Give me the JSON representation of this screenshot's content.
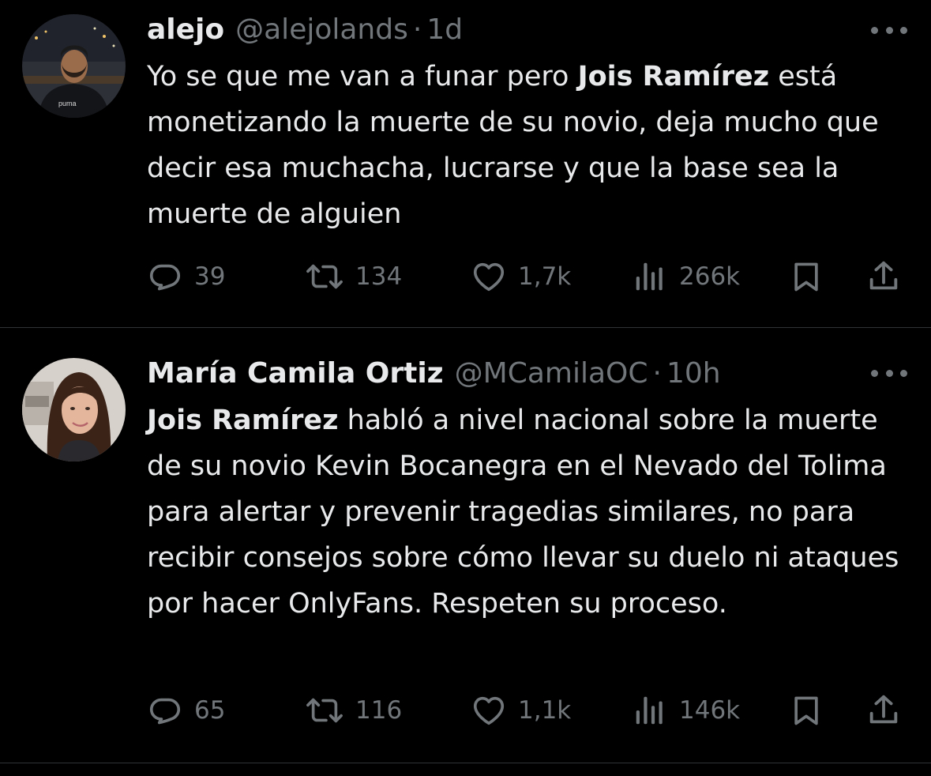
{
  "tweets": [
    {
      "name": "alejo",
      "handle": "@alejolands",
      "separator": "·",
      "time": "1d",
      "text": {
        "part1": "Yo se que me van a funar pero ",
        "bold1": "Jois Ramírez",
        "part2": " está monetizando la muerte de su novio, deja mucho que decir esa muchacha, lucrarse y que la base sea la muerte de alguien"
      },
      "stats": {
        "replies": "39",
        "reposts": "134",
        "likes": "1,7k",
        "views": "266k"
      },
      "avatar": {
        "bg": "#3a3d46",
        "shirt": "#15161a",
        "skin": "#a0714f"
      }
    },
    {
      "name": "María Camila Ortiz",
      "handle": "@MCamilaOC",
      "separator": "·",
      "time": "10h",
      "text": {
        "bold1": "Jois Ramírez",
        "part1": " habló a nivel nacional sobre la muerte de su novio Kevin Bocanegra en el Nevado del Tolima para alertar y prevenir tragedias similares, no para recibir consejos sobre cómo llevar su duelo ni ataques por hacer OnlyFans. Respeten su proceso."
      },
      "stats": {
        "replies": "65",
        "reposts": "116",
        "likes": "1,1k",
        "views": "146k"
      },
      "avatar": {
        "bg": "#d9d4cf",
        "hair": "#3c2419",
        "skin": "#e2b59c"
      }
    }
  ],
  "colors": {
    "background": "#000000",
    "text": "#e7e9ea",
    "secondary": "#71767b",
    "divider": "#2f3336"
  },
  "icons": [
    "reply-icon",
    "repost-icon",
    "like-icon",
    "views-icon",
    "bookmark-icon",
    "share-icon",
    "more-icon"
  ]
}
